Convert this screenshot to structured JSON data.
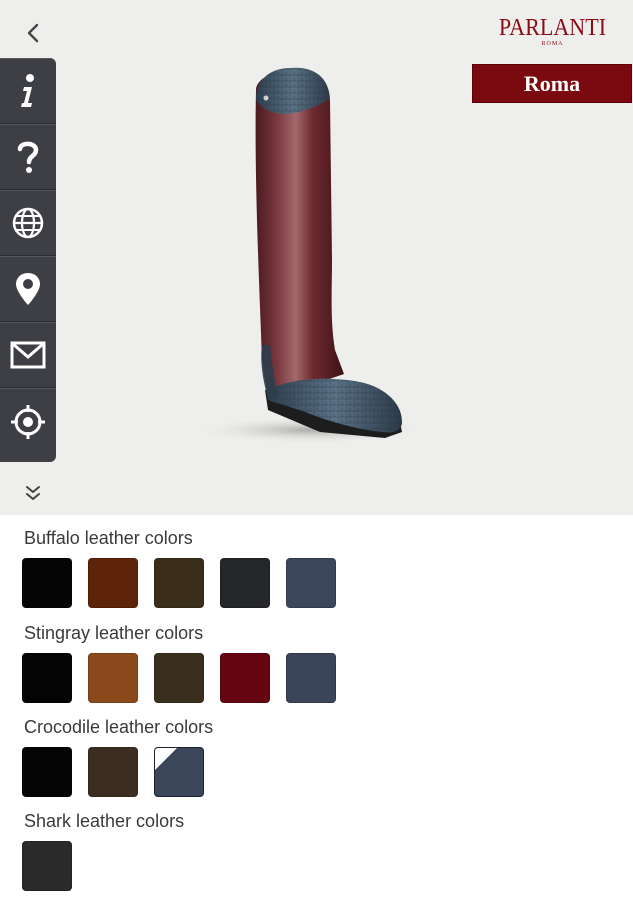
{
  "brand": {
    "name": "PARLANTI",
    "sub": "ROMA"
  },
  "model": {
    "name": "Roma"
  },
  "toolbar": {
    "items": [
      "info-icon",
      "help-icon",
      "globe-icon",
      "location-pin-icon",
      "mail-icon",
      "target-icon"
    ]
  },
  "sections": [
    {
      "title": "Buffalo leather colors",
      "swatches": [
        "#050505",
        "#5e2409",
        "#3a2e1a",
        "#25262a",
        "#3c475b"
      ]
    },
    {
      "title": "Stingray leather colors",
      "swatches": [
        "#050505",
        "#8b4a1c",
        "#3a2e1e",
        "#660611",
        "#3a4559"
      ]
    },
    {
      "title": "Crocodile leather colors",
      "swatches": [
        "#050505",
        "#3b2e20",
        "#3b4659"
      ]
    },
    {
      "title": "Shark leather colors",
      "swatches": [
        "#2a2a2a"
      ]
    }
  ],
  "colors": {
    "accent": "#7a0a0f",
    "toolbar": "#3e3f44",
    "boot_shaft": "#6e2a30",
    "boot_trim": "#3d5266"
  }
}
